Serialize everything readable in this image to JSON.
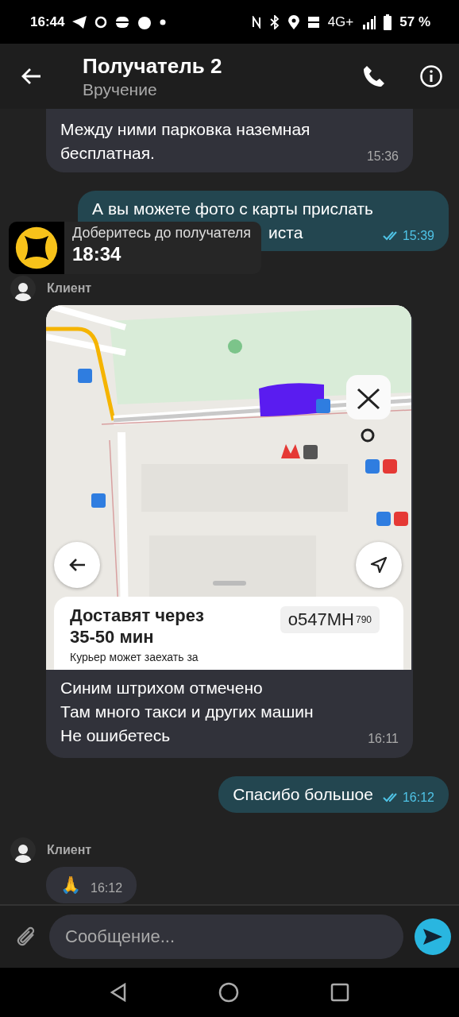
{
  "status_bar": {
    "time": "16:44",
    "network": "4G+",
    "battery": "57 %"
  },
  "header": {
    "title": "Получатель 2",
    "subtitle": "Вручение"
  },
  "messages": [
    {
      "kind": "incoming",
      "lines": [
        "Между ними парковка наземная",
        "бесплатная."
      ],
      "time": "15:36"
    },
    {
      "kind": "outgoing",
      "lines": [
        "А вы можете фото с карты прислать",
        "иста"
      ],
      "time": "15:39",
      "read": true
    },
    {
      "kind": "sender",
      "name": "Клиент"
    },
    {
      "kind": "map",
      "card": {
        "title_lines": [
          "Доставят через",
          "35-50 мин"
        ],
        "note": "Курьер может заехать за",
        "plate": "о547МН",
        "region": "790"
      },
      "lines": [
        "Синим штрихом отмечено",
        "Там много такси и других машин",
        "Не ошибетесь"
      ],
      "time": "16:11"
    },
    {
      "kind": "outgoing",
      "lines": [
        "Спасибо большое"
      ],
      "time": "16:12",
      "read": true
    },
    {
      "kind": "sender",
      "name": "Клиент"
    },
    {
      "kind": "incoming",
      "lines": [
        "🙏"
      ],
      "time": "16:12"
    }
  ],
  "notification": {
    "text": "Доберитесь до получателя",
    "time": "18:34"
  },
  "composer": {
    "placeholder": "Сообщение..."
  }
}
